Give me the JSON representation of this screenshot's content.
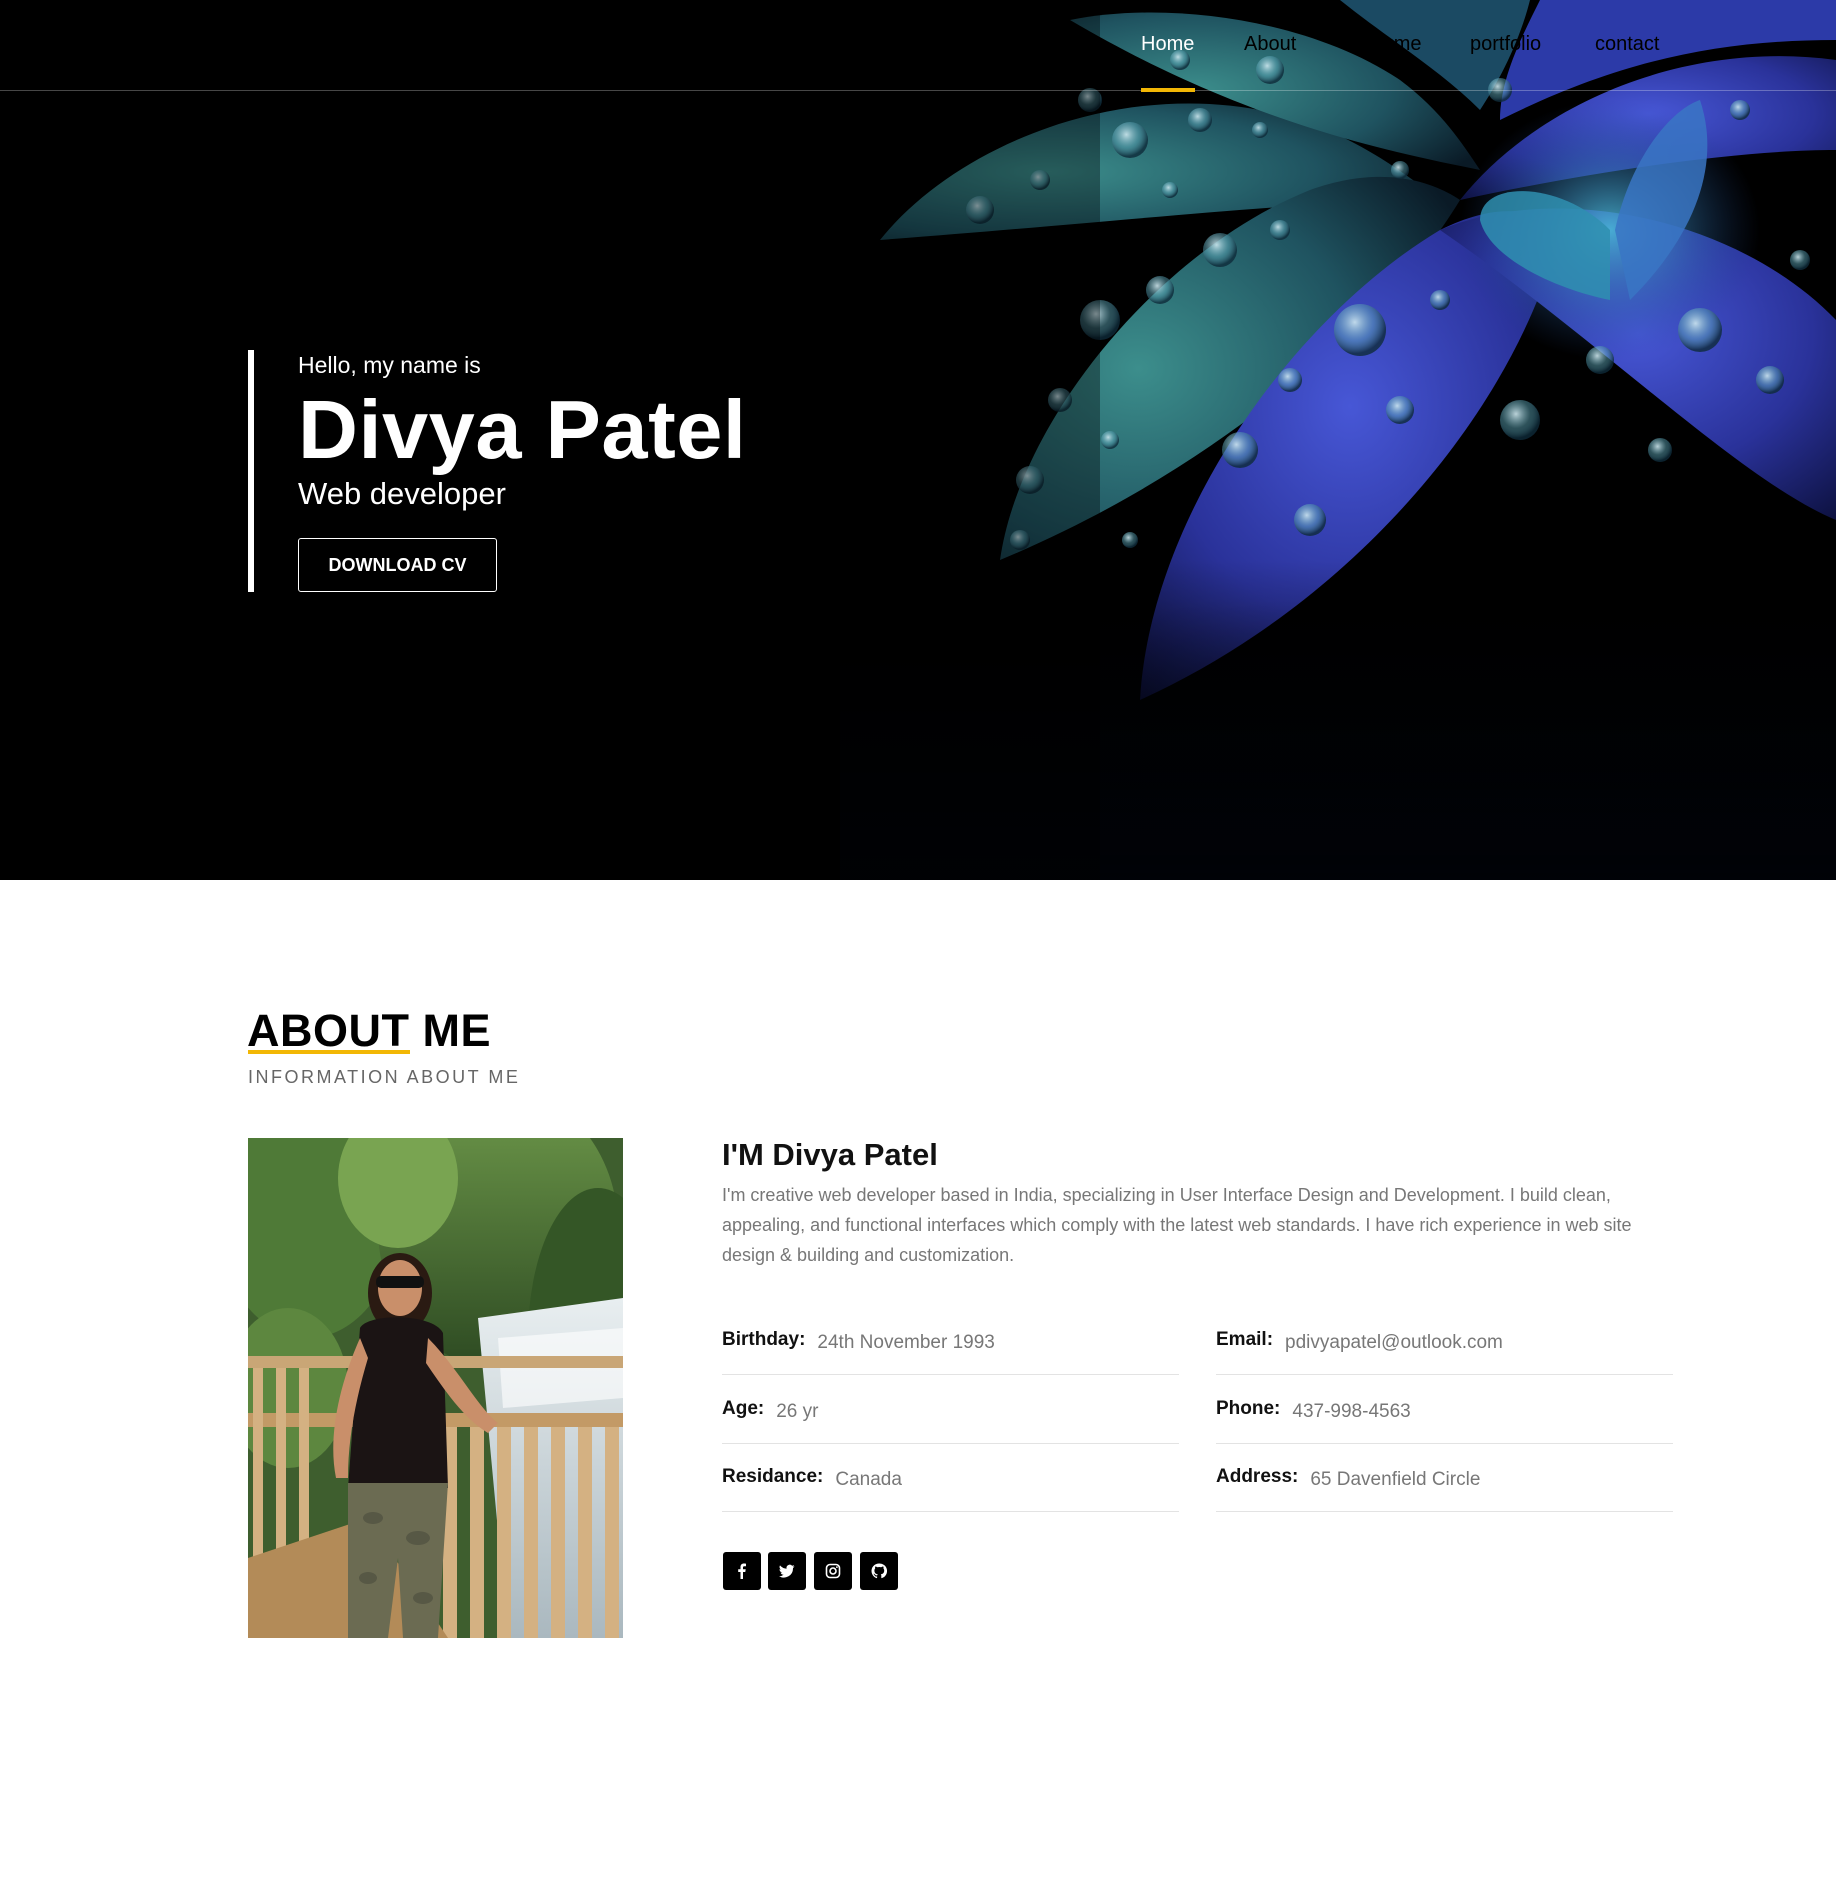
{
  "nav": {
    "items": [
      {
        "label": "Home",
        "active": true
      },
      {
        "label": "About"
      },
      {
        "label": "Resume"
      },
      {
        "label": "portfolio"
      },
      {
        "label": "contact"
      }
    ]
  },
  "hero": {
    "greeting": "Hello, my name is",
    "name": "Divya Patel",
    "role": "Web developer",
    "cta_label": "DOWNLOAD CV"
  },
  "about": {
    "title": "ABOUT ME",
    "subtitle": "INFORMATION ABOUT ME",
    "heading": "I'M Divya Patel",
    "bio": "I'm creative web developer based in India, specializing in User Interface Design and Development. I build clean, appealing, and functional interfaces which comply with the latest web standards. I have rich experience in web site design & building and customization.",
    "details_left": [
      {
        "label": "Birthday:",
        "value": "24th November 1993"
      },
      {
        "label": "Age:",
        "value": "26 yr"
      },
      {
        "label": "Residance:",
        "value": "Canada"
      }
    ],
    "details_right": [
      {
        "label": "Email:",
        "value": "pdivyapatel@outlook.com"
      },
      {
        "label": "Phone:",
        "value": "437-998-4563"
      },
      {
        "label": "Address:",
        "value": "65 Davenfield Circle"
      }
    ],
    "social": [
      "facebook-icon",
      "twitter-icon",
      "instagram-icon",
      "github-icon"
    ]
  },
  "colors": {
    "accent": "#f2b705",
    "hero_bg": "#000000",
    "text_muted": "#777777"
  }
}
